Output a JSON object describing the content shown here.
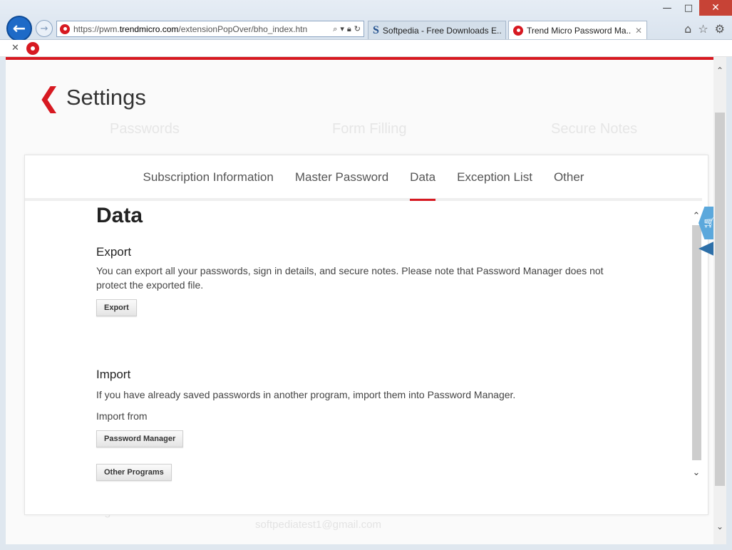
{
  "window": {
    "minimize": "—",
    "maximize": "□",
    "close": "✕"
  },
  "browser": {
    "url_prefix": "https://pwm.",
    "url_domain": "trendmicro.com",
    "url_path": "/extensionPopOver/bho_index.htn",
    "tabs": [
      {
        "label": "Softpedia - Free Downloads E..."
      },
      {
        "label": "Trend Micro Password Ma..."
      }
    ],
    "tab_close": "✕",
    "cmd_close": "✕"
  },
  "background": {
    "categories": [
      "Passwords",
      "Form Filling",
      "Secure Notes"
    ],
    "account_text": "accounts.goo...",
    "email_text": "softpediatest1@gmail.com"
  },
  "page": {
    "heading": "Settings",
    "tabs": [
      {
        "label": "Subscription Information"
      },
      {
        "label": "Master Password"
      },
      {
        "label": "Data",
        "active": true
      },
      {
        "label": "Exception List"
      },
      {
        "label": "Other"
      }
    ]
  },
  "data": {
    "title": "Data",
    "export": {
      "title": "Export",
      "description": "You can export all your passwords, sign in details, and secure notes. Please note that Password Manager does not protect the exported file.",
      "button": "Export"
    },
    "import": {
      "title": "Import",
      "description": "If you have already saved passwords in another program, import them into Password Manager.",
      "from_label": "Import from",
      "buttons": [
        "Password Manager",
        "Other Programs"
      ]
    }
  },
  "colors": {
    "brand_red": "#d71921",
    "ie_blue": "#1e6ac7"
  }
}
